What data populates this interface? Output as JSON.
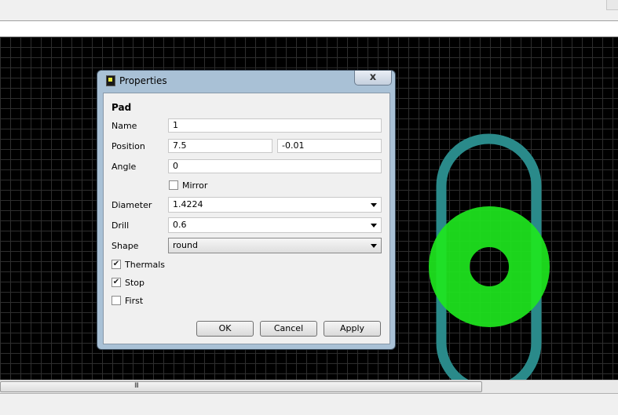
{
  "dialog": {
    "title": "Properties",
    "close_label": "x",
    "section": "Pad",
    "name": {
      "label": "Name",
      "value": "1"
    },
    "position": {
      "label": "Position",
      "x": "7.5",
      "y": "-0.01"
    },
    "angle": {
      "label": "Angle",
      "value": "0"
    },
    "mirror": {
      "label": "Mirror",
      "checked": false
    },
    "diameter": {
      "label": "Diameter",
      "value": "1.4224"
    },
    "drill": {
      "label": "Drill",
      "value": "0.6"
    },
    "shape": {
      "label": "Shape",
      "value": "round"
    },
    "thermals": {
      "label": "Thermals",
      "checked": true
    },
    "stop": {
      "label": "Stop",
      "checked": true
    },
    "first": {
      "label": "First",
      "checked": false
    },
    "buttons": {
      "ok": "OK",
      "cancel": "Cancel",
      "apply": "Apply"
    }
  },
  "scrollbar": {
    "grip": "III"
  },
  "colors": {
    "pad_green": "#1ee61e",
    "outline_teal": "#2a8a8a",
    "canvas": "#000000"
  }
}
